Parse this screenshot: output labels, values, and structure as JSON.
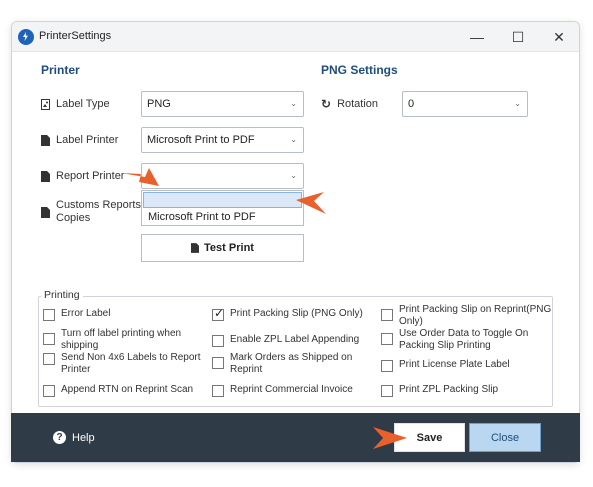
{
  "window": {
    "title": "PrinterSettings",
    "minimize_glyph": "—",
    "maximize_glyph": "☐",
    "close_glyph": "✕"
  },
  "printer": {
    "heading": "Printer",
    "label_type": {
      "label": "Label Type",
      "value": "PNG",
      "icon": "image-file-icon"
    },
    "label_printer": {
      "label": "Label Printer",
      "value": "Microsoft Print to PDF",
      "icon": "file-icon"
    },
    "report_printer": {
      "label": "Report Printer",
      "value": "",
      "icon": "file-icon",
      "dropdown_options": [
        "",
        "Microsoft Print to PDF"
      ]
    },
    "customs_copies": {
      "label_line1": "Customs Reports",
      "label_line2": "Copies",
      "icon": "file-icon"
    },
    "test_print_label": "Test Print"
  },
  "png_settings": {
    "heading": "PNG Settings",
    "rotation": {
      "label": "Rotation",
      "value": "0",
      "icon": "rotate-icon"
    }
  },
  "printing": {
    "legend": "Printing",
    "options": [
      {
        "label_line1": "Error Label",
        "label_line2": "",
        "checked": false
      },
      {
        "label_line1": "Turn off label printing when",
        "label_line2": "shipping",
        "checked": false
      },
      {
        "label_line1": "Send Non 4x6 Labels to Report",
        "label_line2": "Printer",
        "checked": false
      },
      {
        "label_line1": "Append RTN on Reprint Scan",
        "label_line2": "",
        "checked": false
      },
      {
        "label_line1": "Print Packing Slip (PNG Only)",
        "label_line2": "",
        "checked": true
      },
      {
        "label_line1": "Enable ZPL Label Appending",
        "label_line2": "",
        "checked": false
      },
      {
        "label_line1": "Mark Orders as Shipped on",
        "label_line2": "Reprint",
        "checked": false
      },
      {
        "label_line1": "Reprint Commercial Invoice",
        "label_line2": "",
        "checked": false
      },
      {
        "label_line1": "Print Packing Slip on Reprint(PNG",
        "label_line2": "Only)",
        "checked": false
      },
      {
        "label_line1": "Use Order Data to Toggle On",
        "label_line2": "Packing Slip Printing",
        "checked": false
      },
      {
        "label_line1": "Print License Plate Label",
        "label_line2": "",
        "checked": false
      },
      {
        "label_line1": "Print ZPL Packing Slip",
        "label_line2": "",
        "checked": false
      }
    ]
  },
  "footer": {
    "help_label": "Help",
    "save_label": "Save",
    "close_label": "Close"
  },
  "colors": {
    "accent": "#1f4e79",
    "footer_bg": "#2f3b47",
    "close_button_bg": "#b9d7f0",
    "annotation_arrow": "#e8602c"
  }
}
